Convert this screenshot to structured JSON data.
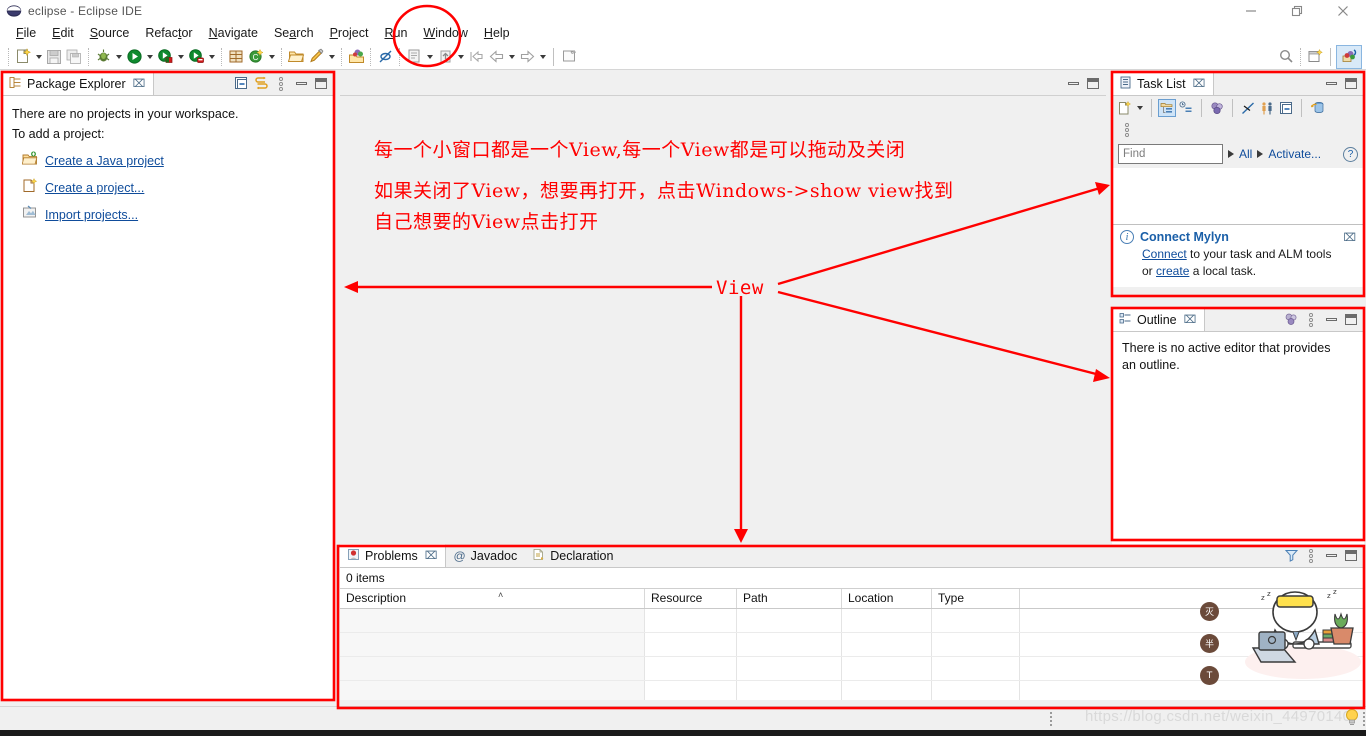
{
  "window": {
    "title": "eclipse - Eclipse IDE",
    "app_icon": "eclipse-icon",
    "minimize_label": "Minimize",
    "restore_label": "Restore",
    "close_label": "Close"
  },
  "menubar": {
    "items": [
      {
        "label": "File",
        "mnemonic": "F"
      },
      {
        "label": "Edit",
        "mnemonic": "E"
      },
      {
        "label": "Source",
        "mnemonic": "S"
      },
      {
        "label": "Refactor",
        "mnemonic": "t"
      },
      {
        "label": "Navigate",
        "mnemonic": "N"
      },
      {
        "label": "Search",
        "mnemonic": "a"
      },
      {
        "label": "Project",
        "mnemonic": "P"
      },
      {
        "label": "Run",
        "mnemonic": "R"
      },
      {
        "label": "Window",
        "mnemonic": "W"
      },
      {
        "label": "Help",
        "mnemonic": "H"
      }
    ]
  },
  "toolbar": {
    "items": [
      {
        "name": "new-wizard",
        "tooltip": "New",
        "has_dropdown": true
      },
      {
        "name": "save",
        "tooltip": "Save",
        "has_dropdown": false
      },
      {
        "name": "save-all",
        "tooltip": "Save All",
        "has_dropdown": false
      },
      {
        "name": "debug",
        "tooltip": "Debug",
        "has_dropdown": true
      },
      {
        "name": "run",
        "tooltip": "Run",
        "has_dropdown": true
      },
      {
        "name": "run-coverage",
        "tooltip": "Coverage",
        "has_dropdown": true
      },
      {
        "name": "run-external-tools",
        "tooltip": "External Tools",
        "has_dropdown": true
      },
      {
        "name": "new-java-package",
        "tooltip": "New Java Package",
        "has_dropdown": false
      },
      {
        "name": "new-java-class",
        "tooltip": "New Java Class",
        "has_dropdown": true
      },
      {
        "name": "open-type",
        "tooltip": "Open Type",
        "has_dropdown": false
      },
      {
        "name": "new-annotation",
        "tooltip": "New Annotation",
        "has_dropdown": true
      },
      {
        "name": "open-task",
        "tooltip": "Open Task",
        "has_dropdown": false
      },
      {
        "name": "deactivate-task",
        "tooltip": "Deactivate Task",
        "has_dropdown": false
      },
      {
        "name": "open-editor",
        "tooltip": "Open Editor",
        "has_dropdown": true
      },
      {
        "name": "next-annotation",
        "tooltip": "Next Annotation",
        "has_dropdown": true
      },
      {
        "name": "previous-edit-location",
        "tooltip": "Previous Edit Location",
        "has_dropdown": false
      },
      {
        "name": "back",
        "tooltip": "Back",
        "has_dropdown": true
      },
      {
        "name": "forward",
        "tooltip": "Forward",
        "has_dropdown": true
      },
      {
        "name": "new-untitled-text-file",
        "tooltip": "New Untitled Text File",
        "has_dropdown": false
      }
    ],
    "right_items": [
      {
        "name": "quick-access-search",
        "tooltip": "Quick Access"
      },
      {
        "name": "open-perspective",
        "tooltip": "Open Perspective"
      },
      {
        "name": "java-perspective",
        "tooltip": "Java",
        "selected": true
      }
    ]
  },
  "package_explorer": {
    "tab_label": "Package Explorer",
    "tab_icon": "package-explorer-icon",
    "close_glyph": "⌧",
    "toolbar": [
      {
        "name": "collapse-all-icon",
        "tooltip": "Collapse All"
      },
      {
        "name": "link-with-editor-icon",
        "tooltip": "Link with Editor"
      },
      {
        "name": "view-menu-icon",
        "tooltip": "View Menu"
      },
      {
        "name": "minimize-icon",
        "tooltip": "Minimize"
      },
      {
        "name": "maximize-icon",
        "tooltip": "Maximize"
      }
    ],
    "empty_line1": "There are no projects in your workspace.",
    "empty_line2": "To add a project:",
    "links": [
      {
        "label": "Create a Java project",
        "icon": "new-java-project-icon"
      },
      {
        "label": "Create a project...",
        "icon": "new-project-icon"
      },
      {
        "label": "Import projects...",
        "icon": "import-projects-icon"
      }
    ]
  },
  "editor_area": {
    "toolbar": [
      {
        "name": "minimize-icon",
        "tooltip": "Minimize"
      },
      {
        "name": "maximize-icon",
        "tooltip": "Maximize"
      }
    ]
  },
  "task_list": {
    "tab_label": "Task List",
    "tab_icon": "task-list-icon",
    "close_glyph": "⌧",
    "toolbar": [
      {
        "name": "new-task-icon",
        "tooltip": "New Task",
        "has_dropdown": true
      },
      {
        "name": "categorized-mode-icon",
        "tooltip": "Categorized",
        "selected": true
      },
      {
        "name": "scheduled-mode-icon",
        "tooltip": "Scheduled"
      },
      {
        "name": "synchronize-changed-icon",
        "tooltip": "Synchronize Changed"
      },
      {
        "name": "focus-on-workweek-icon",
        "tooltip": "Focus on Workweek"
      },
      {
        "name": "show-all-tasks-icon",
        "tooltip": "Show All Tasks"
      },
      {
        "name": "collapse-all-icon",
        "tooltip": "Collapse All"
      },
      {
        "name": "restore-tasks-icon",
        "tooltip": "Restore Tasks"
      }
    ],
    "view_menu_icon": "view-menu-icon",
    "minimize_icon": "minimize-icon",
    "maximize_icon": "maximize-icon",
    "find_placeholder": "Find",
    "find_value": "",
    "filter_all_label": "All",
    "filter_activate_label": "Activate...",
    "help_icon": "help-icon",
    "mylyn": {
      "info_icon": "info-icon",
      "title": "Connect Mylyn",
      "close_glyph": "⌧",
      "body_prefix": "",
      "link1": "Connect",
      "text1": " to your task and ALM tools",
      "text2": "or ",
      "link2": "create",
      "text3": " a local task."
    }
  },
  "outline": {
    "tab_label": "Outline",
    "tab_icon": "outline-icon",
    "close_glyph": "⌧",
    "toolbar": [
      {
        "name": "focus-icon",
        "tooltip": "Focus"
      },
      {
        "name": "view-menu-icon",
        "tooltip": "View Menu"
      },
      {
        "name": "minimize-icon",
        "tooltip": "Minimize"
      },
      {
        "name": "maximize-icon",
        "tooltip": "Maximize"
      }
    ],
    "empty_line1": "There is no active editor that provides",
    "empty_line2": "an outline."
  },
  "problems": {
    "tabs": [
      {
        "label": "Problems",
        "icon": "problems-icon",
        "active": true,
        "close_glyph": "⌧"
      },
      {
        "label": "Javadoc",
        "icon": "javadoc-icon",
        "active": false
      },
      {
        "label": "Declaration",
        "icon": "declaration-icon",
        "active": false
      }
    ],
    "toolbar": [
      {
        "name": "filter-icon",
        "tooltip": "Filters"
      },
      {
        "name": "view-menu-icon",
        "tooltip": "View Menu"
      },
      {
        "name": "minimize-icon",
        "tooltip": "Minimize"
      },
      {
        "name": "maximize-icon",
        "tooltip": "Maximize"
      }
    ],
    "item_count_label": "0 items",
    "columns": [
      "Description",
      "Resource",
      "Path",
      "Location",
      "Type"
    ],
    "sort_column": "Description",
    "sort_caret": "˄",
    "rows": []
  },
  "annotations": {
    "line1": "每一个小窗口都是一个View,每一个View都是可以拖动及关闭",
    "line2": "如果关闭了View，想要再打开，点击Windows->show view找到",
    "line3": "自己想要的View点击打开",
    "view_label": "View",
    "highlight_menu": "Window",
    "color": "#ff0000"
  },
  "statusbar": {
    "watermark": "https://blog.csdn.net/weixin_44970140",
    "hint_icon": "lightbulb-icon"
  },
  "badges": [
    {
      "label": "灭"
    },
    {
      "label": "半"
    },
    {
      "label": "T"
    }
  ]
}
